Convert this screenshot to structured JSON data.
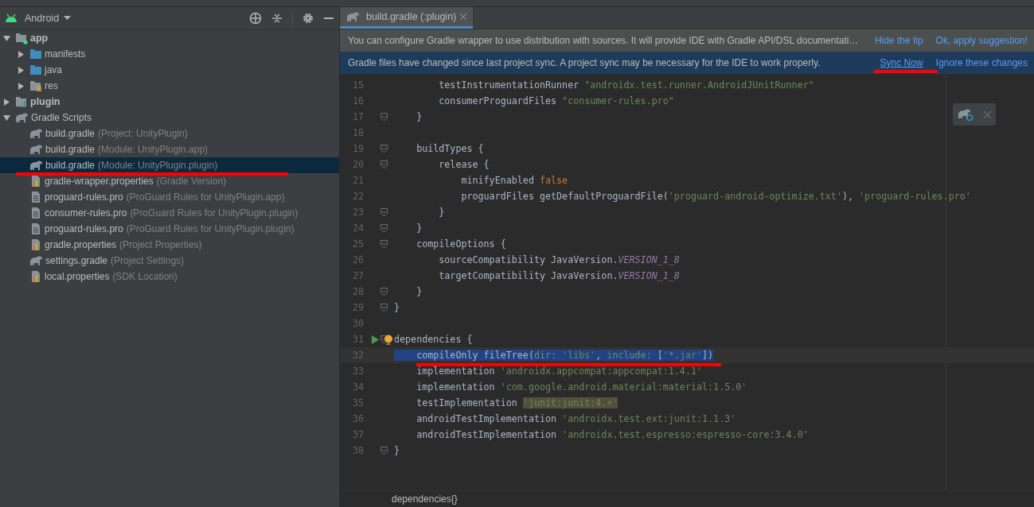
{
  "project_panel": {
    "view_selector": "Android",
    "tree": [
      {
        "kind": "module",
        "name": "app",
        "expanded": true,
        "selected": false,
        "children": [
          {
            "kind": "folder",
            "name": "manifests",
            "expanded": false,
            "selected": false
          },
          {
            "kind": "folder",
            "name": "java",
            "expanded": false,
            "selected": false
          },
          {
            "kind": "res",
            "name": "res",
            "expanded": false,
            "selected": false
          }
        ]
      },
      {
        "kind": "library",
        "name": "plugin",
        "expanded": false,
        "selected": false
      },
      {
        "kind": "gradle",
        "name": "Gradle Scripts",
        "expanded": true,
        "selected": false,
        "children": [
          {
            "kind": "gradle",
            "name": "build.gradle",
            "hint": "(Project: UnityPlugin)",
            "selected": false
          },
          {
            "kind": "gradle",
            "name": "build.gradle",
            "hint": "(Module: UnityPlugin.app)",
            "selected": false
          },
          {
            "kind": "gradle",
            "name": "build.gradle",
            "hint": "(Module: UnityPlugin.plugin)",
            "selected": true,
            "marked": true
          },
          {
            "kind": "properties",
            "name": "gradle-wrapper.properties",
            "hint": "(Gradle Version)",
            "selected": false
          },
          {
            "kind": "file",
            "name": "proguard-rules.pro",
            "hint": "(ProGuard Rules for UnityPlugin.app)",
            "selected": false
          },
          {
            "kind": "file",
            "name": "consumer-rules.pro",
            "hint": "(ProGuard Rules for UnityPlugin.plugin)",
            "selected": false
          },
          {
            "kind": "file",
            "name": "proguard-rules.pro",
            "hint": "(ProGuard Rules for UnityPlugin.plugin)",
            "selected": false
          },
          {
            "kind": "properties",
            "name": "gradle.properties",
            "hint": "(Project Properties)",
            "selected": false
          },
          {
            "kind": "gradle",
            "name": "settings.gradle",
            "hint": "(Project Settings)",
            "selected": false
          },
          {
            "kind": "properties",
            "name": "local.properties",
            "hint": "(SDK Location)",
            "selected": false
          }
        ]
      }
    ]
  },
  "editor": {
    "tabs": [
      {
        "label": "build.gradle (:plugin)",
        "selected": true
      }
    ],
    "banners": [
      {
        "kind": "tip",
        "text": "You can configure Gradle wrapper to use distribution with sources. It will provide IDE with Gradle API/DSL documentati…",
        "actions": [
          {
            "label": "Hide the tip",
            "marked": false
          },
          {
            "label": "Ok, apply suggestion!",
            "marked": false
          }
        ]
      },
      {
        "kind": "sync",
        "text": "Gradle files have changed since last project sync. A project sync may be necessary for the IDE to work properly.",
        "actions": [
          {
            "label": "Sync Now",
            "marked": true
          },
          {
            "label": "Ignore these changes",
            "marked": false
          }
        ]
      }
    ],
    "lines": [
      {
        "number": "15",
        "fold": false,
        "tokens": [
          {
            "kind": "plain",
            "text": "        testInstrumentationRunner "
          },
          {
            "kind": "string",
            "text": "\"androidx.test.runner.AndroidJUnitRunner\""
          }
        ]
      },
      {
        "number": "16",
        "fold": false,
        "tokens": [
          {
            "kind": "plain",
            "text": "        consumerProguardFiles "
          },
          {
            "kind": "string",
            "text": "\"consumer-rules.pro\""
          }
        ]
      },
      {
        "number": "17",
        "fold": true,
        "tokens": [
          {
            "kind": "plain",
            "text": "    }"
          }
        ]
      },
      {
        "number": "18",
        "fold": false
      },
      {
        "number": "19",
        "fold": true,
        "tokens": [
          {
            "kind": "plain",
            "text": "    buildTypes {"
          }
        ]
      },
      {
        "number": "20",
        "fold": true,
        "tokens": [
          {
            "kind": "plain",
            "text": "        release {"
          }
        ]
      },
      {
        "number": "21",
        "fold": false,
        "tokens": [
          {
            "kind": "plain",
            "text": "            minifyEnabled "
          },
          {
            "kind": "keyword",
            "text": "false"
          }
        ]
      },
      {
        "number": "22",
        "fold": false,
        "tokens": [
          {
            "kind": "plain",
            "text": "            proguardFiles getDefaultProguardFile("
          },
          {
            "kind": "string",
            "text": "'proguard-android-optimize.txt'"
          },
          {
            "kind": "plain",
            "text": "), "
          },
          {
            "kind": "string",
            "text": "'proguard-rules.pro'"
          }
        ]
      },
      {
        "number": "23",
        "fold": true,
        "tokens": [
          {
            "kind": "plain",
            "text": "        }"
          }
        ]
      },
      {
        "number": "24",
        "fold": true,
        "tokens": [
          {
            "kind": "plain",
            "text": "    }"
          }
        ]
      },
      {
        "number": "25",
        "fold": true,
        "tokens": [
          {
            "kind": "plain",
            "text": "    compileOptions {"
          }
        ]
      },
      {
        "number": "26",
        "fold": false,
        "tokens": [
          {
            "kind": "plain",
            "text": "        sourceCompatibility JavaVersion."
          },
          {
            "kind": "constant",
            "text": "VERSION_1_8"
          }
        ]
      },
      {
        "number": "27",
        "fold": false,
        "tokens": [
          {
            "kind": "plain",
            "text": "        targetCompatibility JavaVersion."
          },
          {
            "kind": "constant",
            "text": "VERSION_1_8"
          }
        ]
      },
      {
        "number": "28",
        "fold": true,
        "tokens": [
          {
            "kind": "plain",
            "text": "    }"
          }
        ]
      },
      {
        "number": "29",
        "fold": true,
        "tokens": [
          {
            "kind": "plain",
            "text": "}"
          }
        ]
      },
      {
        "number": "30",
        "fold": false
      },
      {
        "number": "31",
        "fold": true,
        "runnable": true,
        "tokens": [
          {
            "kind": "plain",
            "text": "dependencies {"
          }
        ]
      },
      {
        "number": "32",
        "fold": false,
        "selected": true,
        "marked": true,
        "tokens": [
          {
            "kind": "plain",
            "text": "    compileOnly fileTree("
          },
          {
            "kind": "param",
            "text": "dir: "
          },
          {
            "kind": "string",
            "text": "'libs'"
          },
          {
            "kind": "plain",
            "text": ", "
          },
          {
            "kind": "param",
            "text": "include: "
          },
          {
            "kind": "plain",
            "text": "["
          },
          {
            "kind": "string",
            "text": "'*.jar'"
          },
          {
            "kind": "plain",
            "text": "])"
          }
        ]
      },
      {
        "number": "33",
        "fold": false,
        "tokens": [
          {
            "kind": "plain",
            "text": "    implementation "
          },
          {
            "kind": "string",
            "text": "'androidx.appcompat:appcompat:1.4.1'"
          }
        ]
      },
      {
        "number": "34",
        "fold": false,
        "tokens": [
          {
            "kind": "plain",
            "text": "    implementation "
          },
          {
            "kind": "string",
            "text": "'com.google.android.material:material:1.5.0'"
          }
        ]
      },
      {
        "number": "35",
        "fold": false,
        "tokens": [
          {
            "kind": "plain",
            "text": "    testImplementation "
          },
          {
            "kind": "warning",
            "text": "'junit:junit:4.+'"
          }
        ]
      },
      {
        "number": "36",
        "fold": false,
        "tokens": [
          {
            "kind": "plain",
            "text": "    androidTestImplementation "
          },
          {
            "kind": "string",
            "text": "'androidx.test.ext:junit:1.1.3'"
          }
        ]
      },
      {
        "number": "37",
        "fold": false,
        "tokens": [
          {
            "kind": "plain",
            "text": "    androidTestImplementation "
          },
          {
            "kind": "string",
            "text": "'androidx.test.espresso:espresso-core:3.4.0'"
          }
        ]
      },
      {
        "number": "38",
        "fold": true,
        "tokens": [
          {
            "kind": "plain",
            "text": "}"
          }
        ]
      }
    ],
    "breadcrumb": "dependencies{}"
  }
}
